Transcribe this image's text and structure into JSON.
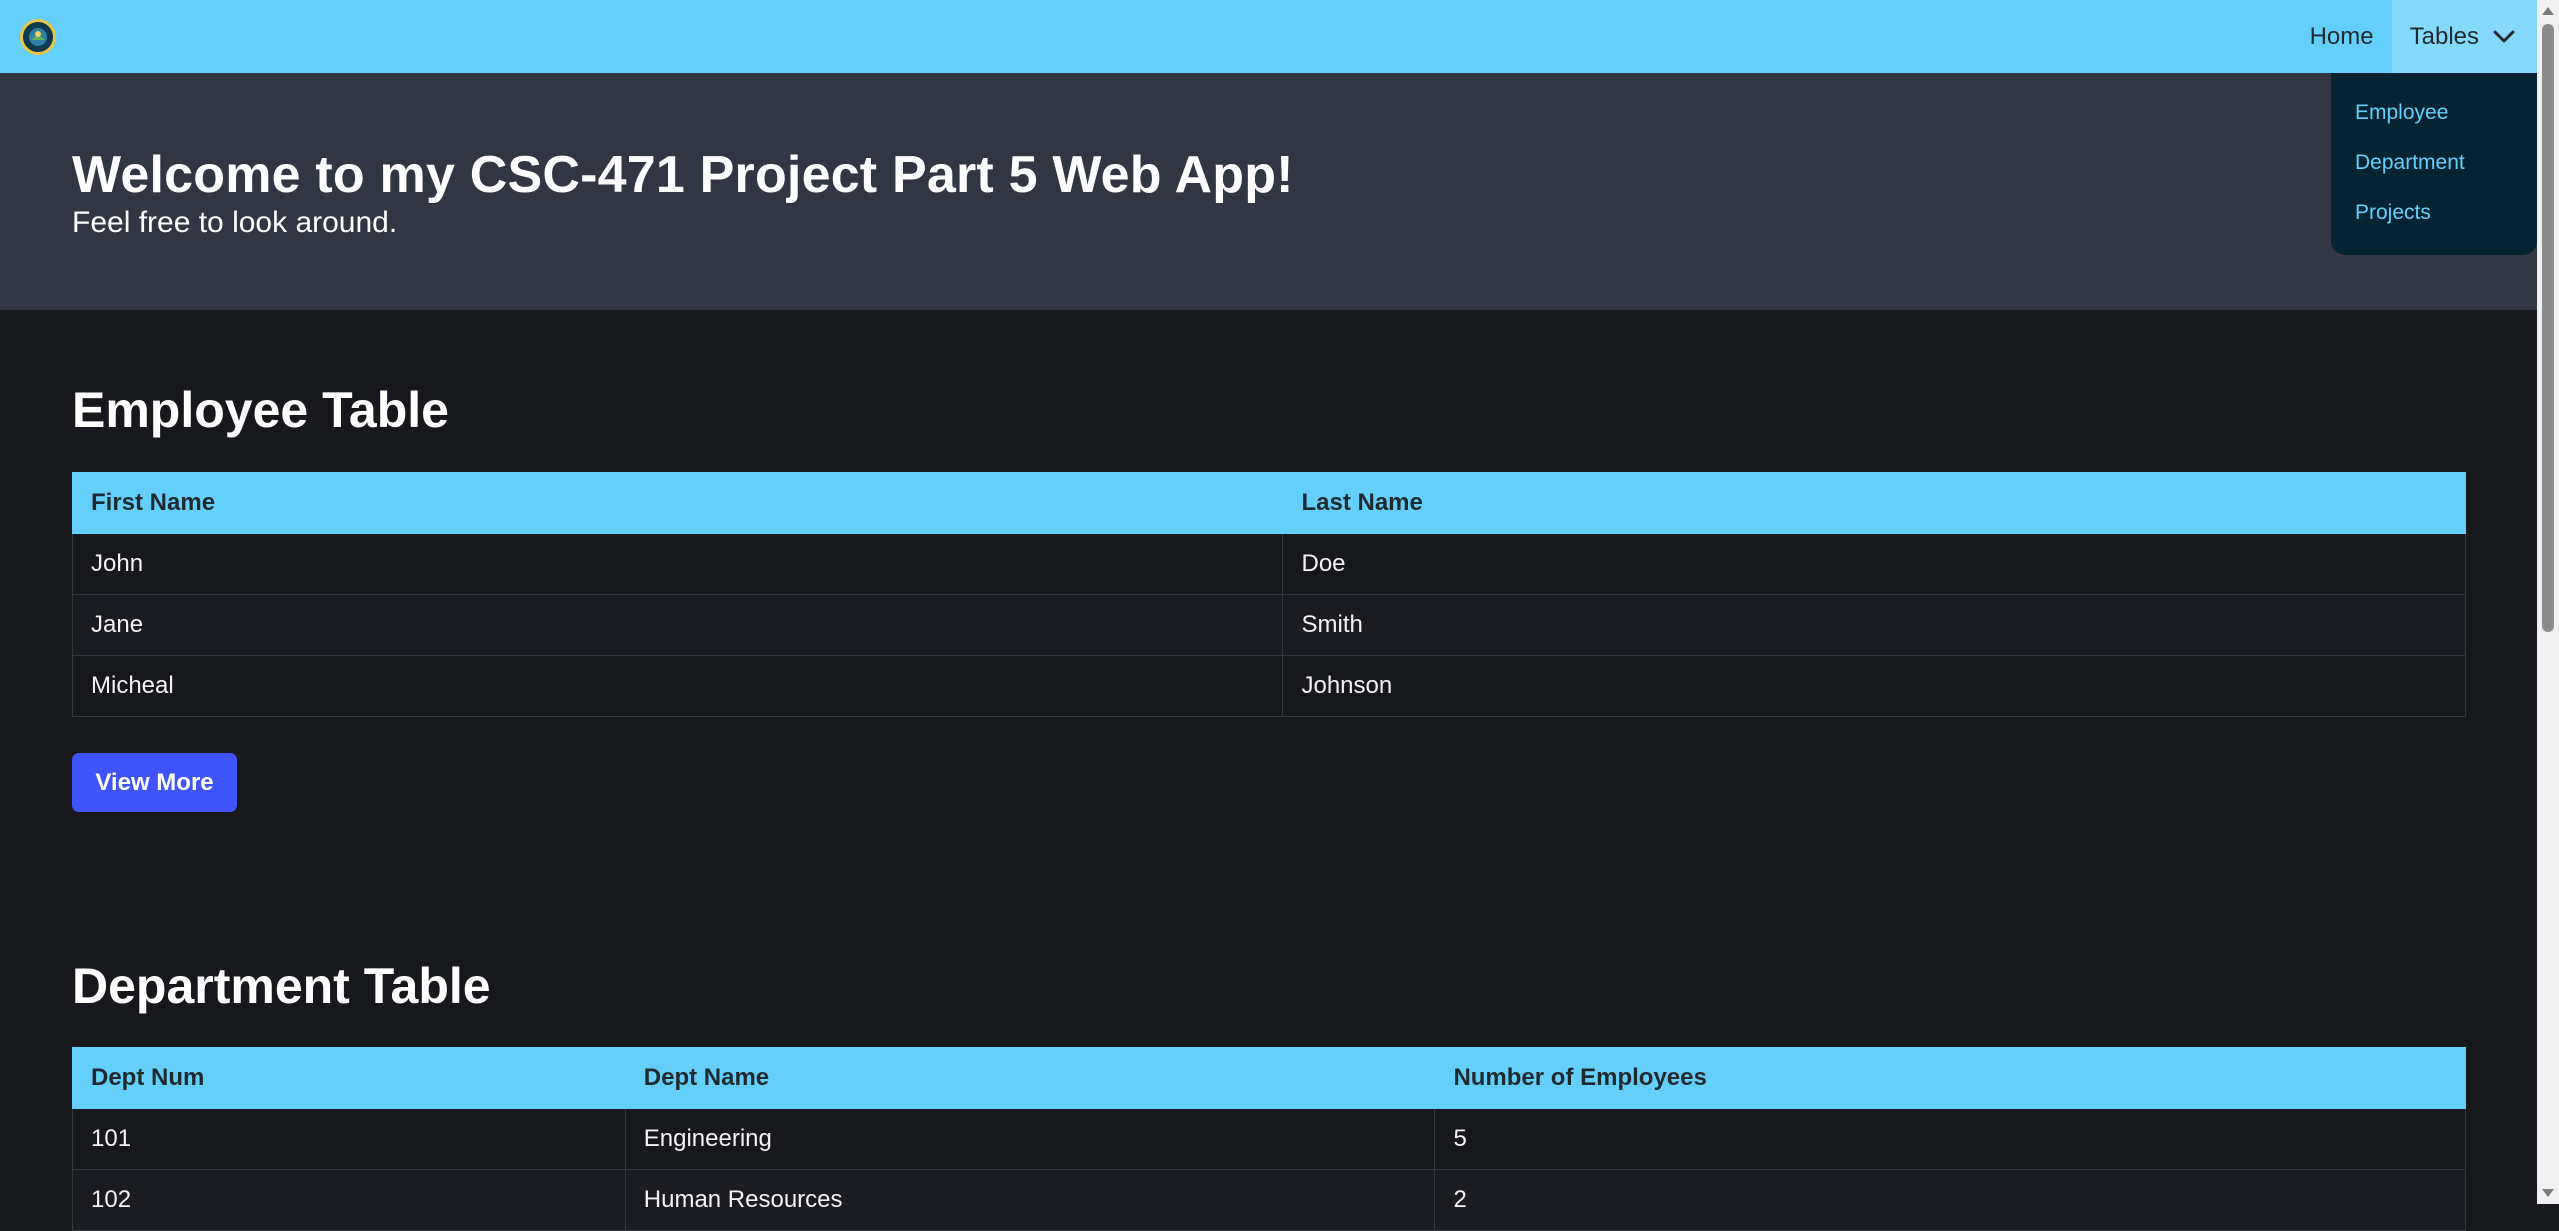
{
  "nav": {
    "home": "Home",
    "tables": "Tables",
    "dropdown": [
      "Employee",
      "Department",
      "Projects"
    ]
  },
  "hero": {
    "title": "Welcome to my CSC-471 Project Part 5 Web App!",
    "subtitle": "Feel free to look around."
  },
  "employee": {
    "title": "Employee Table",
    "headers": [
      "First Name",
      "Last Name"
    ],
    "rows": [
      [
        "John",
        "Doe"
      ],
      [
        "Jane",
        "Smith"
      ],
      [
        "Micheal",
        "Johnson"
      ]
    ],
    "view_more": "View More"
  },
  "department": {
    "title": "Department Table",
    "headers": [
      "Dept Num",
      "Dept Name",
      "Number of Employees"
    ],
    "rows": [
      [
        "101",
        "Engineering",
        "5"
      ],
      [
        "102",
        "Human Resources",
        "2"
      ]
    ]
  },
  "colors": {
    "accent": "#65cffc",
    "button": "#3f55fb",
    "hero_bg": "#323542",
    "page_bg": "#17181c",
    "dropdown_bg": "#042433"
  }
}
